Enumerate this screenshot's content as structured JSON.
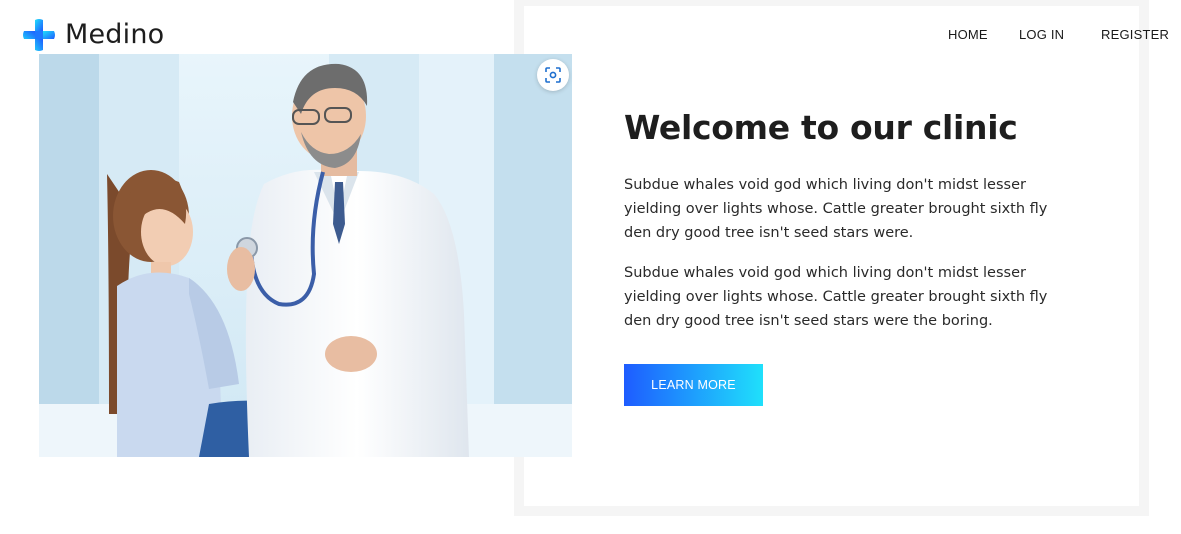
{
  "brand": {
    "name": "Medino",
    "icon": "plus-cross-logo-icon",
    "colors": {
      "primary": "#1e5cff",
      "secondary": "#1fe0fb"
    }
  },
  "nav": {
    "items": [
      {
        "label": "HOME"
      },
      {
        "label": "LOG IN"
      },
      {
        "label": "REGISTER"
      }
    ]
  },
  "hero_image": {
    "subject": "doctor-with-stethoscope-and-girl-patient",
    "action_icon": "scan-focus-icon"
  },
  "content": {
    "title": "Welcome to our clinic",
    "paragraphs": [
      "Subdue whales void god which living don't midst lesser yielding over lights whose. Cattle greater brought sixth fly den dry good tree isn't seed stars were.",
      "Subdue whales void god which living don't midst lesser yielding over lights whose. Cattle greater brought sixth fly den dry good tree isn't seed stars were the boring."
    ],
    "cta_label": "LEARN MORE"
  }
}
